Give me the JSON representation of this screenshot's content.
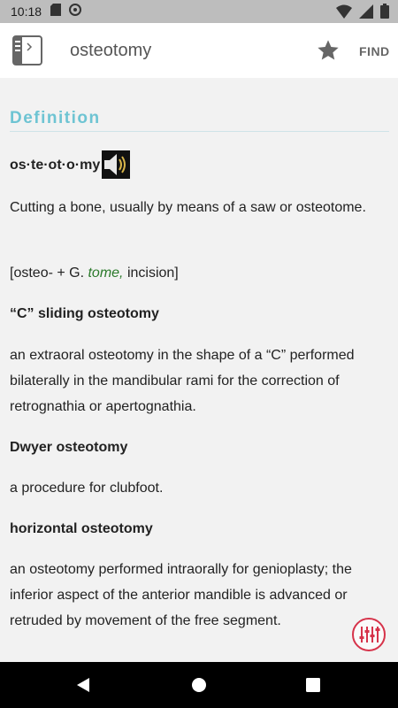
{
  "status_bar": {
    "time": "10:18",
    "left_icons": [
      "sd-card-icon",
      "sync-icon"
    ],
    "right_icons": [
      "wifi-icon",
      "cellular-icon",
      "battery-icon"
    ]
  },
  "app_bar": {
    "title": "osteotomy",
    "find_label": "FIND",
    "icons": [
      "book-icon",
      "star-icon"
    ]
  },
  "content": {
    "section_heading": "Definition",
    "headword": "os·te·ot·o·my",
    "definition": "Cutting a bone, usually by means of a saw or osteotome.",
    "etymology": {
      "prefix": "[osteo- + G. ",
      "term": "tome,",
      "suffix": " incision]"
    },
    "subentries": [
      {
        "term": "“C” sliding osteotomy",
        "definition": "an extraoral osteotomy in the shape of a “C” performed bilaterally in the mandibular rami for the correction of retrognathia or apertognathia."
      },
      {
        "term": "Dwyer osteotomy",
        "definition": "a procedure for clubfoot."
      },
      {
        "term": "horizontal osteotomy",
        "definition": "an osteotomy performed intraorally for genioplasty; the inferior aspect of the anterior mandible is advanced or retruded by movement of the free segment."
      }
    ]
  },
  "colors": {
    "accent": "#6ec4d3",
    "etymology_term": "#2b7a2b",
    "fab": "#d6334a"
  }
}
